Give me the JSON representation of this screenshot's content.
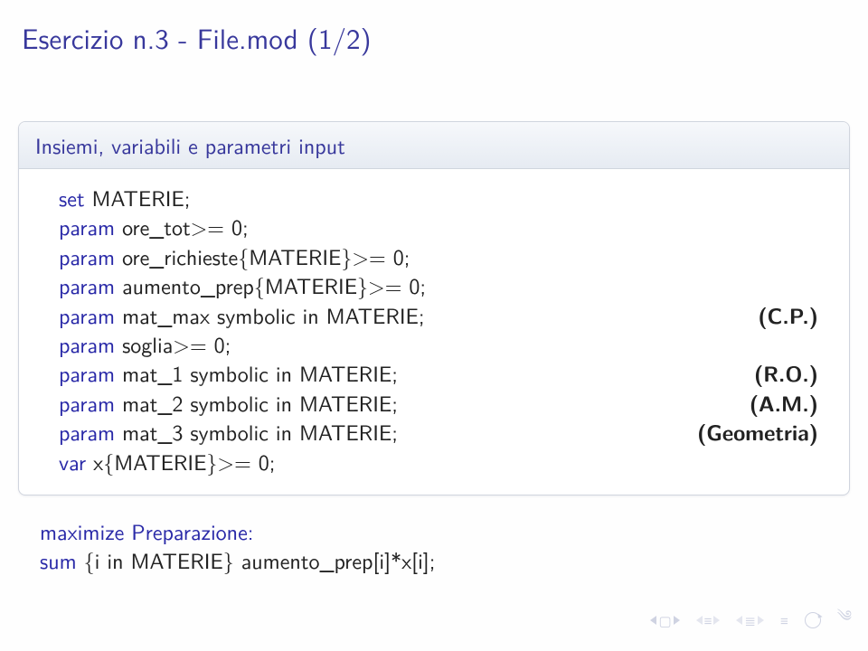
{
  "slide": {
    "title": "Esercizio n.3 - File.mod (1/2)",
    "card_header": "Insiemi, variabili e parametri input",
    "lines": [
      {
        "lhs_kw": "set",
        "lhs_rest": " MATERIE;",
        "rhs": ""
      },
      {
        "lhs_kw": "param",
        "lhs_rest": " ore_tot>= 0;",
        "rhs": ""
      },
      {
        "lhs_kw": "param",
        "lhs_rest": " ore_richieste{MATERIE}>= 0;",
        "rhs": ""
      },
      {
        "lhs_kw": "param",
        "lhs_rest": " aumento_prep{MATERIE}>= 0;",
        "rhs": ""
      },
      {
        "lhs_kw": "param",
        "lhs_rest": " mat_max symbolic in MATERIE;",
        "rhs": "(C.P.)"
      },
      {
        "lhs_kw": "param",
        "lhs_rest": " soglia>= 0;",
        "rhs": ""
      },
      {
        "lhs_kw": "param",
        "lhs_rest": " mat_1 symbolic in MATERIE;",
        "rhs": "(R.O.)"
      },
      {
        "lhs_kw": "param",
        "lhs_rest": " mat_2 symbolic in MATERIE;",
        "rhs": "(A.M.)"
      },
      {
        "lhs_kw": "param",
        "lhs_rest": " mat_3 symbolic in MATERIE;",
        "rhs": "(Geometria)"
      },
      {
        "lhs_kw": "var",
        "lhs_rest": " x{MATERIE}>= 0;",
        "rhs": ""
      }
    ],
    "below1": "maximize Preparazione:",
    "below2_pre": "sum ",
    "below2_blk": "{i in MATERIE} aumento_prep[i]*x[i];"
  },
  "nav": {
    "first": "first-slide",
    "prev": "prev-slide",
    "next": "next-slide",
    "last": "last-slide",
    "prev_section": "prev-section",
    "next_section": "next-section",
    "prev_sub": "prev-subsection",
    "next_sub": "next-subsection",
    "loop": "toggle-loop"
  }
}
